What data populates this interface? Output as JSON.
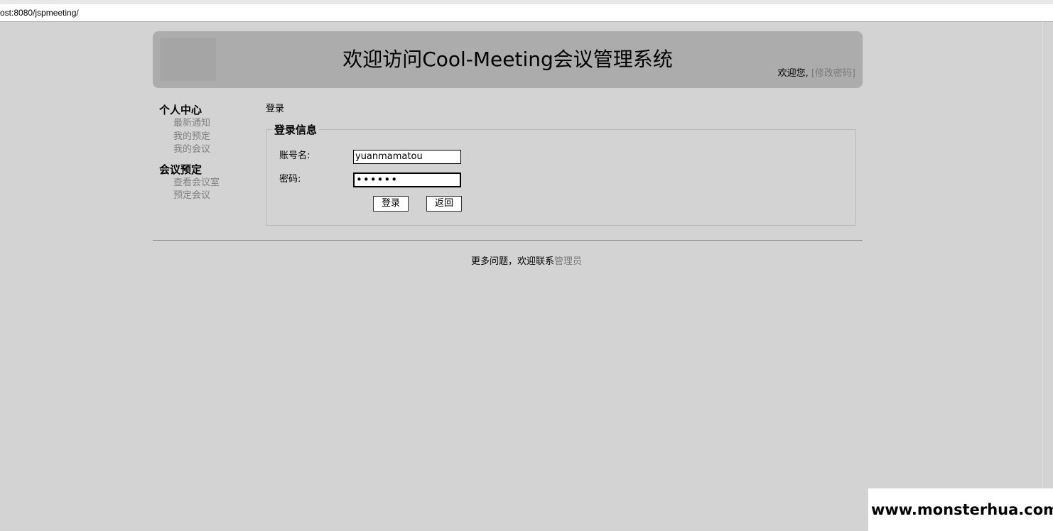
{
  "browser": {
    "url": "ost:8080/jspmeeting/"
  },
  "header": {
    "title": "欢迎访问Cool-Meeting会议管理系统",
    "welcome_text": "欢迎您,",
    "change_password_link": "[修改密码]"
  },
  "sidebar": {
    "groups": [
      {
        "title": "个人中心",
        "items": [
          "最新通知",
          "我的预定",
          "我的会议"
        ]
      },
      {
        "title": "会议预定",
        "items": [
          "查看会议室",
          "预定会议"
        ]
      }
    ]
  },
  "main": {
    "breadcrumb": "登录",
    "login_form": {
      "legend": "登录信息",
      "username_label": "账号名:",
      "username_value": "yuanmamatou",
      "password_label": "密码:",
      "password_masked": "••••••",
      "login_button": "登录",
      "back_button": "返回"
    }
  },
  "footer": {
    "text": "更多问题，欢迎联系",
    "admin_link": "管理员"
  },
  "watermark": {
    "text": "www.monsterhua.com"
  },
  "colors": {
    "page_bg": "#d3d3d3",
    "header_bg": "#acacac",
    "link_gray": "#808080"
  }
}
